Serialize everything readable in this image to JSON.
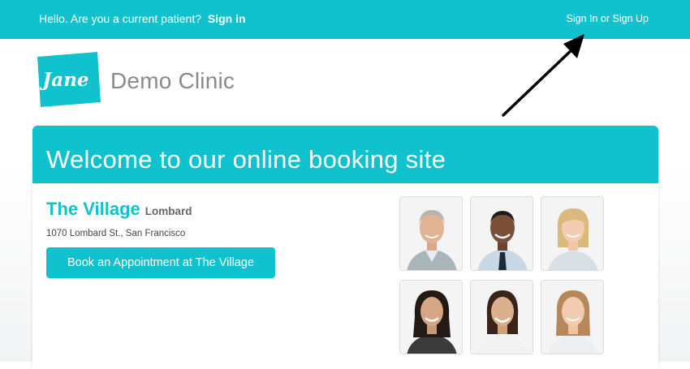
{
  "header": {
    "greeting": "Hello. Are you a current patient?",
    "signin_label": "Sign in",
    "auth_link": "Sign In or Sign Up"
  },
  "brand": {
    "logo_text": "Jane",
    "clinic_name": "Demo Clinic",
    "accent_color": "#0fc2cd"
  },
  "welcome": {
    "title": "Welcome to our online booking site"
  },
  "location": {
    "name": "The Village",
    "area": "Lombard",
    "address": "1070 Lombard St., San Francisco",
    "book_label": "Book an Appointment at The Village"
  },
  "staff_photos": [
    {
      "icon": "practitioner-photo"
    },
    {
      "icon": "practitioner-photo"
    },
    {
      "icon": "practitioner-photo"
    },
    {
      "icon": "practitioner-photo"
    },
    {
      "icon": "practitioner-photo"
    },
    {
      "icon": "practitioner-photo"
    }
  ]
}
